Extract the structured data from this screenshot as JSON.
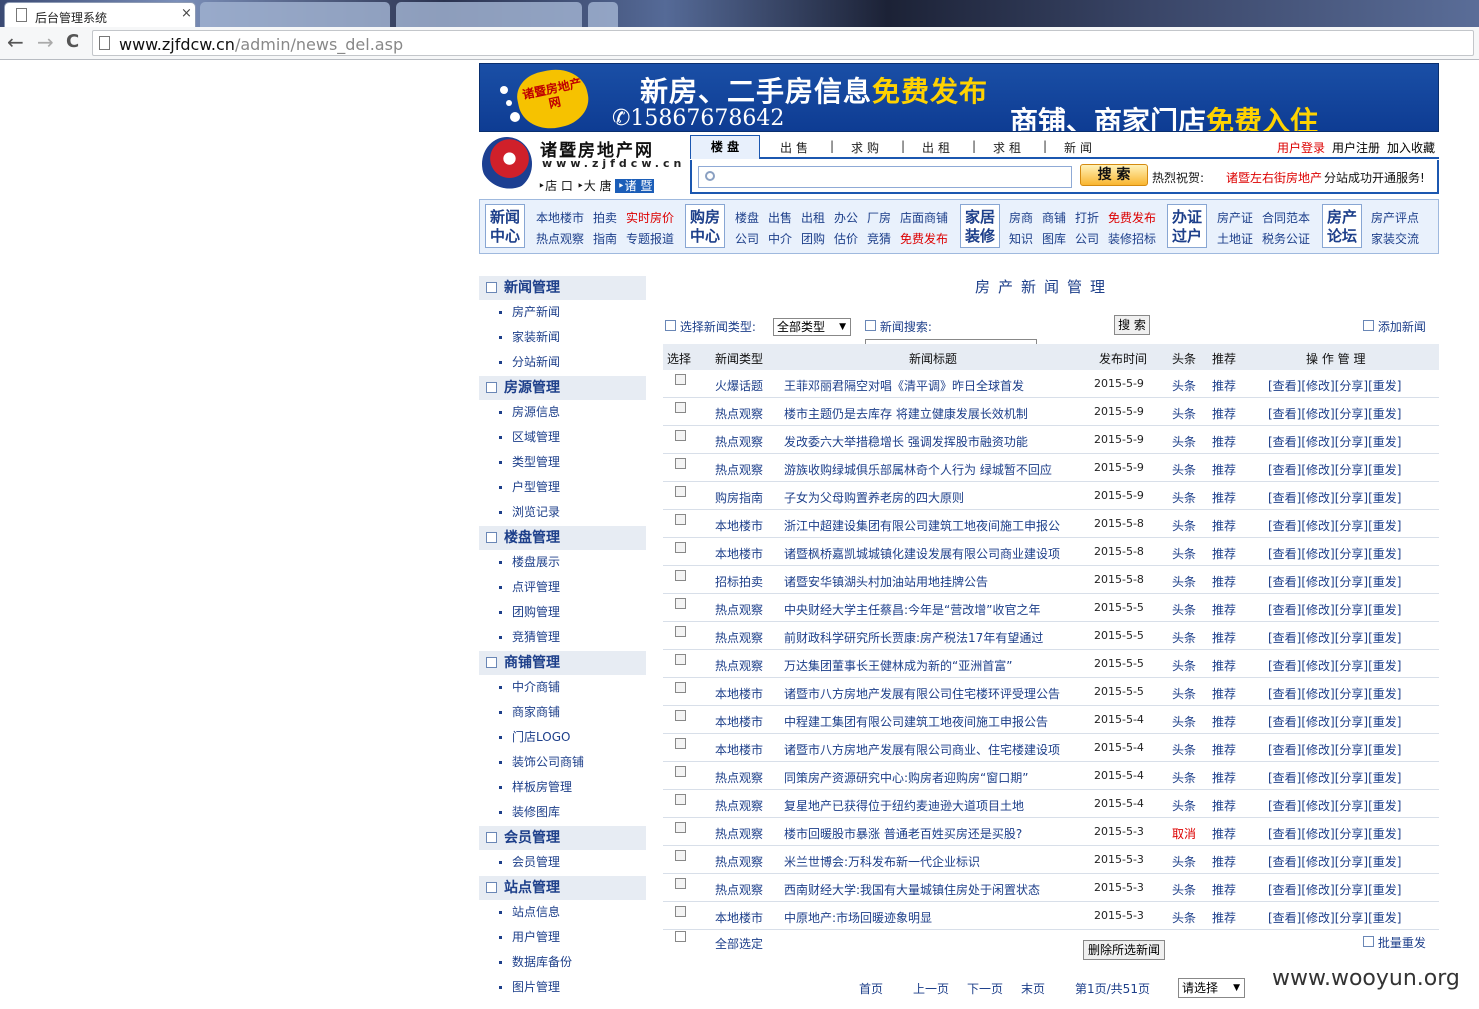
{
  "browser": {
    "tab_title": "后台管理系统",
    "tab_close": "×",
    "back": "←",
    "forward": "→",
    "reload": "C",
    "url_host": "www.zjfdcw.cn",
    "url_path": "/admin/news_del.asp"
  },
  "banner": {
    "badge": "诸暨房地产网",
    "line1_prefix": "新房、二手房信息",
    "line1_highlight": "免费发布",
    "phone": "✆15867678642",
    "line2_prefix": "商铺、商家门店",
    "line2_highlight": "免费入住"
  },
  "site": {
    "name": "诸暨房地产网",
    "url": "www.zjfdcw.cn",
    "sub_prefix": "‣店 口 ‣大 唐",
    "sub_highlight": "‣诸 暨"
  },
  "topnav": {
    "active": "楼 盘",
    "items": [
      "出售",
      "求购",
      "出租",
      "求租",
      "新闻"
    ],
    "login": "用户登录",
    "register": "用户注册",
    "favorite": "加入收藏"
  },
  "search": {
    "button": "搜 索",
    "hot_label": "热烈祝贺:",
    "hot_news": "诸暨左右街房地产",
    "hot_news2": "分站成功开通服务!"
  },
  "catnav": {
    "groups": [
      {
        "box": "新闻中心",
        "links": [
          [
            "本地楼市",
            "拍卖",
            "实时房价"
          ],
          [
            "热点观察",
            "指南",
            "专题报道"
          ]
        ]
      },
      {
        "box": "购房中心",
        "links": [
          [
            "楼盘",
            "出售",
            "出租",
            "办公",
            "厂房",
            "店面商铺"
          ],
          [
            "公司",
            "中介",
            "团购",
            "估价",
            "竞猜",
            "免费发布"
          ]
        ]
      },
      {
        "box": "家居装修",
        "links": [
          [
            "房商",
            "商铺",
            "打折",
            "免费发布"
          ],
          [
            "知识",
            "图库",
            "公司",
            "装修招标"
          ]
        ]
      },
      {
        "box": "办证过户",
        "links": [
          [
            "房产证",
            "合同范本"
          ],
          [
            "土地证",
            "税务公证"
          ]
        ]
      },
      {
        "box": "房产论坛",
        "links": [
          [
            "房产评点"
          ],
          [
            "家装交流"
          ]
        ]
      }
    ]
  },
  "sidebar": {
    "sections": [
      {
        "title": "新闻管理",
        "items": [
          "房产新闻",
          "家装新闻",
          "分站新闻"
        ]
      },
      {
        "title": "房源管理",
        "items": [
          "房源信息",
          "区域管理",
          "类型管理",
          "户型管理",
          "浏览记录"
        ]
      },
      {
        "title": "楼盘管理",
        "items": [
          "楼盘展示",
          "点评管理",
          "团购管理",
          "竞猜管理"
        ]
      },
      {
        "title": "商铺管理",
        "items": [
          "中介商铺",
          "商家商铺",
          "门店LOGO",
          "装饰公司商铺",
          "样板房管理",
          "装修图库"
        ]
      },
      {
        "title": "会员管理",
        "items": [
          "会员管理"
        ]
      },
      {
        "title": "站点管理",
        "items": [
          "站点信息",
          "用户管理",
          "数据库备份",
          "图片管理"
        ]
      }
    ]
  },
  "main": {
    "title": "房产新闻管理",
    "filter_type_label": "选择新闻类型:",
    "filter_type_value": "全部类型",
    "news_search_label": "新闻搜索:",
    "search_button": "搜 索",
    "add_news": "添加新闻",
    "columns": [
      "选择",
      "新闻类型",
      "新闻标题",
      "发布时间",
      "头条",
      "推荐",
      "操 作 管 理"
    ],
    "ops": "[查看][修改][分享][重发]",
    "rows": [
      {
        "type": "火爆话题",
        "title": "王菲邓丽君隔空对唱《清平调》昨日全球首发",
        "date": "2015-5-9",
        "top": "头条",
        "rec": "推荐"
      },
      {
        "type": "热点观察",
        "title": "楼市主题仍是去库存 将建立健康发展长效机制",
        "date": "2015-5-9",
        "top": "头条",
        "rec": "推荐"
      },
      {
        "type": "热点观察",
        "title": "发改委六大举措稳增长 强调发挥股市融资功能",
        "date": "2015-5-9",
        "top": "头条",
        "rec": "推荐"
      },
      {
        "type": "热点观察",
        "title": "游族收购绿城俱乐部属林奇个人行为 绿城暂不回应",
        "date": "2015-5-9",
        "top": "头条",
        "rec": "推荐"
      },
      {
        "type": "购房指南",
        "title": "子女为父母购置养老房的四大原则",
        "date": "2015-5-9",
        "top": "头条",
        "rec": "推荐"
      },
      {
        "type": "本地楼市",
        "title": "浙江中超建设集团有限公司建筑工地夜间施工申报公",
        "date": "2015-5-8",
        "top": "头条",
        "rec": "推荐"
      },
      {
        "type": "本地楼市",
        "title": "诸暨枫桥嘉凯城城镇化建设发展有限公司商业建设项",
        "date": "2015-5-8",
        "top": "头条",
        "rec": "推荐"
      },
      {
        "type": "招标拍卖",
        "title": "诸暨安华镇湖头村加油站用地挂牌公告",
        "date": "2015-5-8",
        "top": "头条",
        "rec": "推荐"
      },
      {
        "type": "热点观察",
        "title": "中央财经大学主任蔡昌:今年是“营改增”收官之年",
        "date": "2015-5-5",
        "top": "头条",
        "rec": "推荐"
      },
      {
        "type": "热点观察",
        "title": "前财政科学研究所长贾康:房产税法17年有望通过",
        "date": "2015-5-5",
        "top": "头条",
        "rec": "推荐"
      },
      {
        "type": "热点观察",
        "title": "万达集团董事长王健林成为新的“亚洲首富”",
        "date": "2015-5-5",
        "top": "头条",
        "rec": "推荐"
      },
      {
        "type": "本地楼市",
        "title": "诸暨市八方房地产发展有限公司住宅楼环评受理公告",
        "date": "2015-5-5",
        "top": "头条",
        "rec": "推荐"
      },
      {
        "type": "本地楼市",
        "title": "中程建工集团有限公司建筑工地夜间施工申报公告",
        "date": "2015-5-4",
        "top": "头条",
        "rec": "推荐"
      },
      {
        "type": "本地楼市",
        "title": "诸暨市八方房地产发展有限公司商业、住宅楼建设项",
        "date": "2015-5-4",
        "top": "头条",
        "rec": "推荐"
      },
      {
        "type": "热点观察",
        "title": "同策房产资源研究中心:购房者迎购房“窗口期”",
        "date": "2015-5-4",
        "top": "头条",
        "rec": "推荐"
      },
      {
        "type": "热点观察",
        "title": "复星地产已获得位于纽约麦迪逊大道项目土地",
        "date": "2015-5-4",
        "top": "头条",
        "rec": "推荐"
      },
      {
        "type": "热点观察",
        "title": "楼市回暖股市暴涨 普通老百姓买房还是买股?",
        "date": "2015-5-3",
        "top": "取消",
        "rec": "推荐",
        "top_red": true
      },
      {
        "type": "热点观察",
        "title": "米兰世博会:万科发布新一代企业标识",
        "date": "2015-5-3",
        "top": "头条",
        "rec": "推荐"
      },
      {
        "type": "热点观察",
        "title": "西南财经大学:我国有大量城镇住房处于闲置状态",
        "date": "2015-5-3",
        "top": "头条",
        "rec": "推荐"
      },
      {
        "type": "本地楼市",
        "title": "中原地产:市场回暖迹象明显",
        "date": "2015-5-3",
        "top": "头条",
        "rec": "推荐"
      }
    ],
    "select_all": "全部选定",
    "delete_button": "删除所选新闻",
    "batch_repost": "批量重发",
    "pager": {
      "first": "首页",
      "prev": "上一页",
      "next": "下一页",
      "last": "末页",
      "info": "第1页/共51页",
      "select": "请选择"
    }
  },
  "watermark": "www.wooyun.org"
}
